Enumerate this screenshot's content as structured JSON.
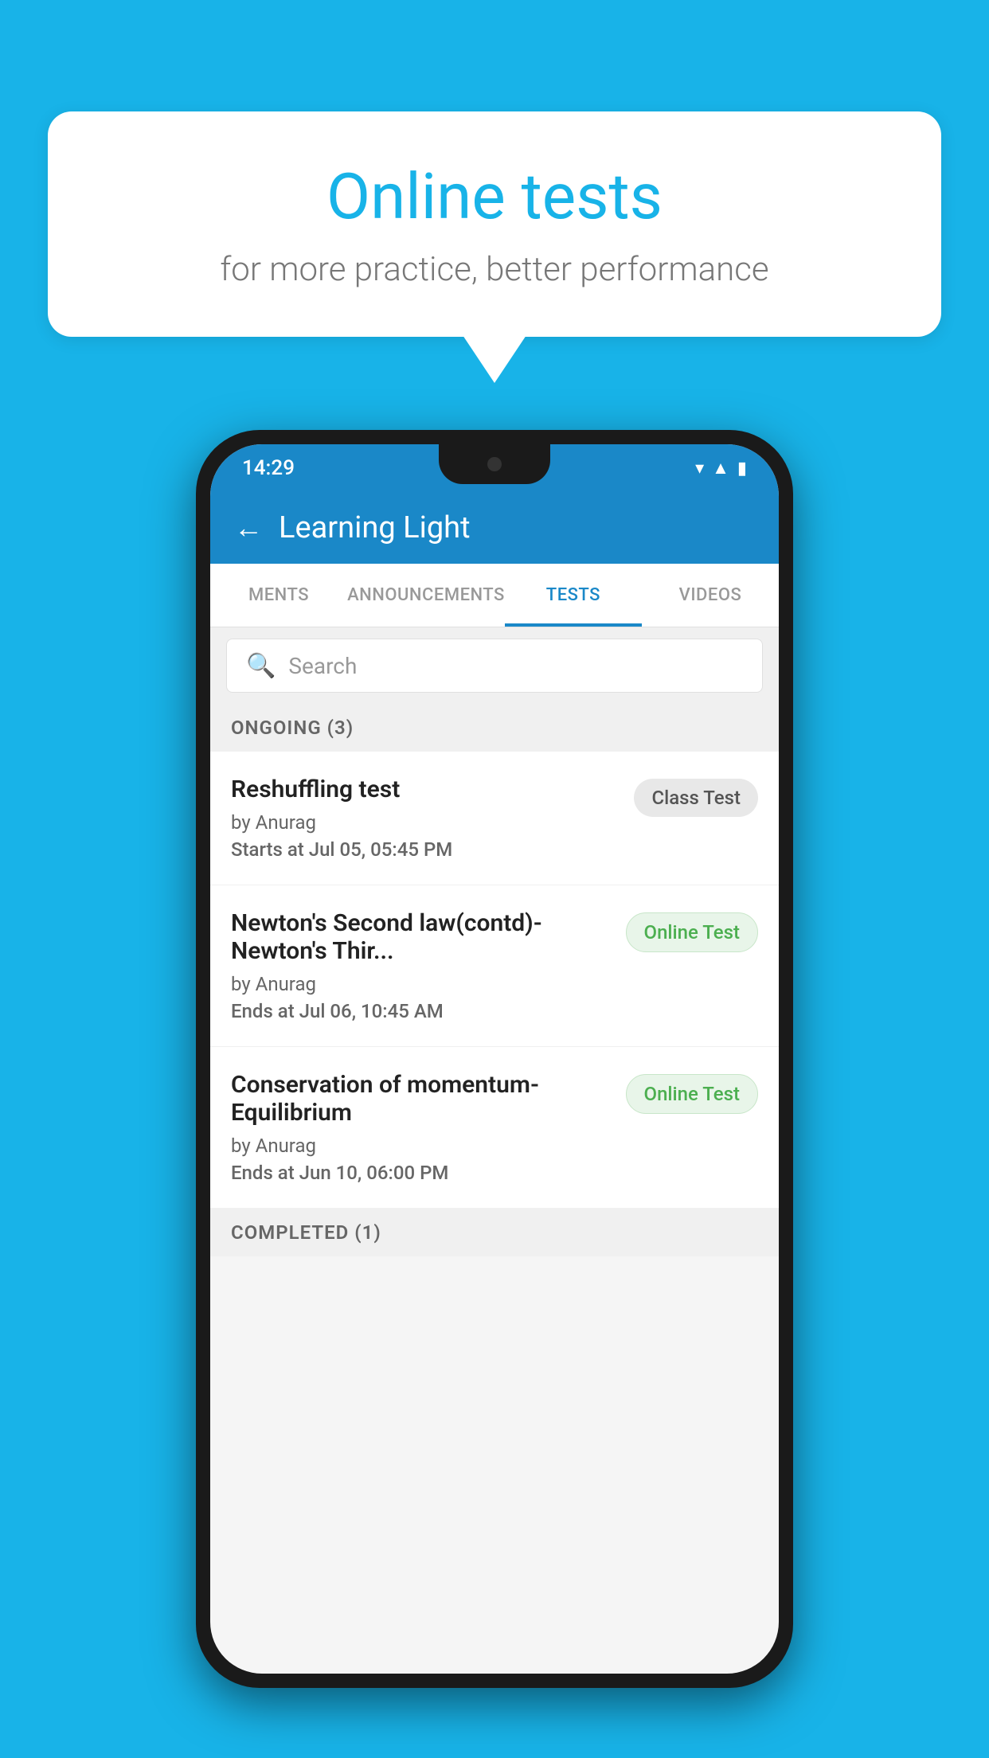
{
  "background": {
    "color": "#18b3e8"
  },
  "speech_bubble": {
    "title": "Online tests",
    "subtitle": "for more practice, better performance"
  },
  "phone": {
    "status_bar": {
      "time": "14:29",
      "icons": [
        "wifi",
        "signal",
        "battery"
      ]
    },
    "app_bar": {
      "title": "Learning Light",
      "back_label": "←"
    },
    "tabs": [
      {
        "label": "MENTS",
        "active": false
      },
      {
        "label": "ANNOUNCEMENTS",
        "active": false
      },
      {
        "label": "TESTS",
        "active": true
      },
      {
        "label": "VIDEOS",
        "active": false
      }
    ],
    "search": {
      "placeholder": "Search"
    },
    "ongoing_section": {
      "label": "ONGOING (3)",
      "tests": [
        {
          "name": "Reshuffling test",
          "author": "by Anurag",
          "time_label": "Starts at",
          "time_value": "Jul 05, 05:45 PM",
          "badge": "Class Test",
          "badge_type": "class"
        },
        {
          "name": "Newton's Second law(contd)-Newton's Thir...",
          "author": "by Anurag",
          "time_label": "Ends at",
          "time_value": "Jul 06, 10:45 AM",
          "badge": "Online Test",
          "badge_type": "online"
        },
        {
          "name": "Conservation of momentum-Equilibrium",
          "author": "by Anurag",
          "time_label": "Ends at",
          "time_value": "Jun 10, 06:00 PM",
          "badge": "Online Test",
          "badge_type": "online"
        }
      ]
    },
    "completed_section": {
      "label": "COMPLETED (1)"
    }
  }
}
